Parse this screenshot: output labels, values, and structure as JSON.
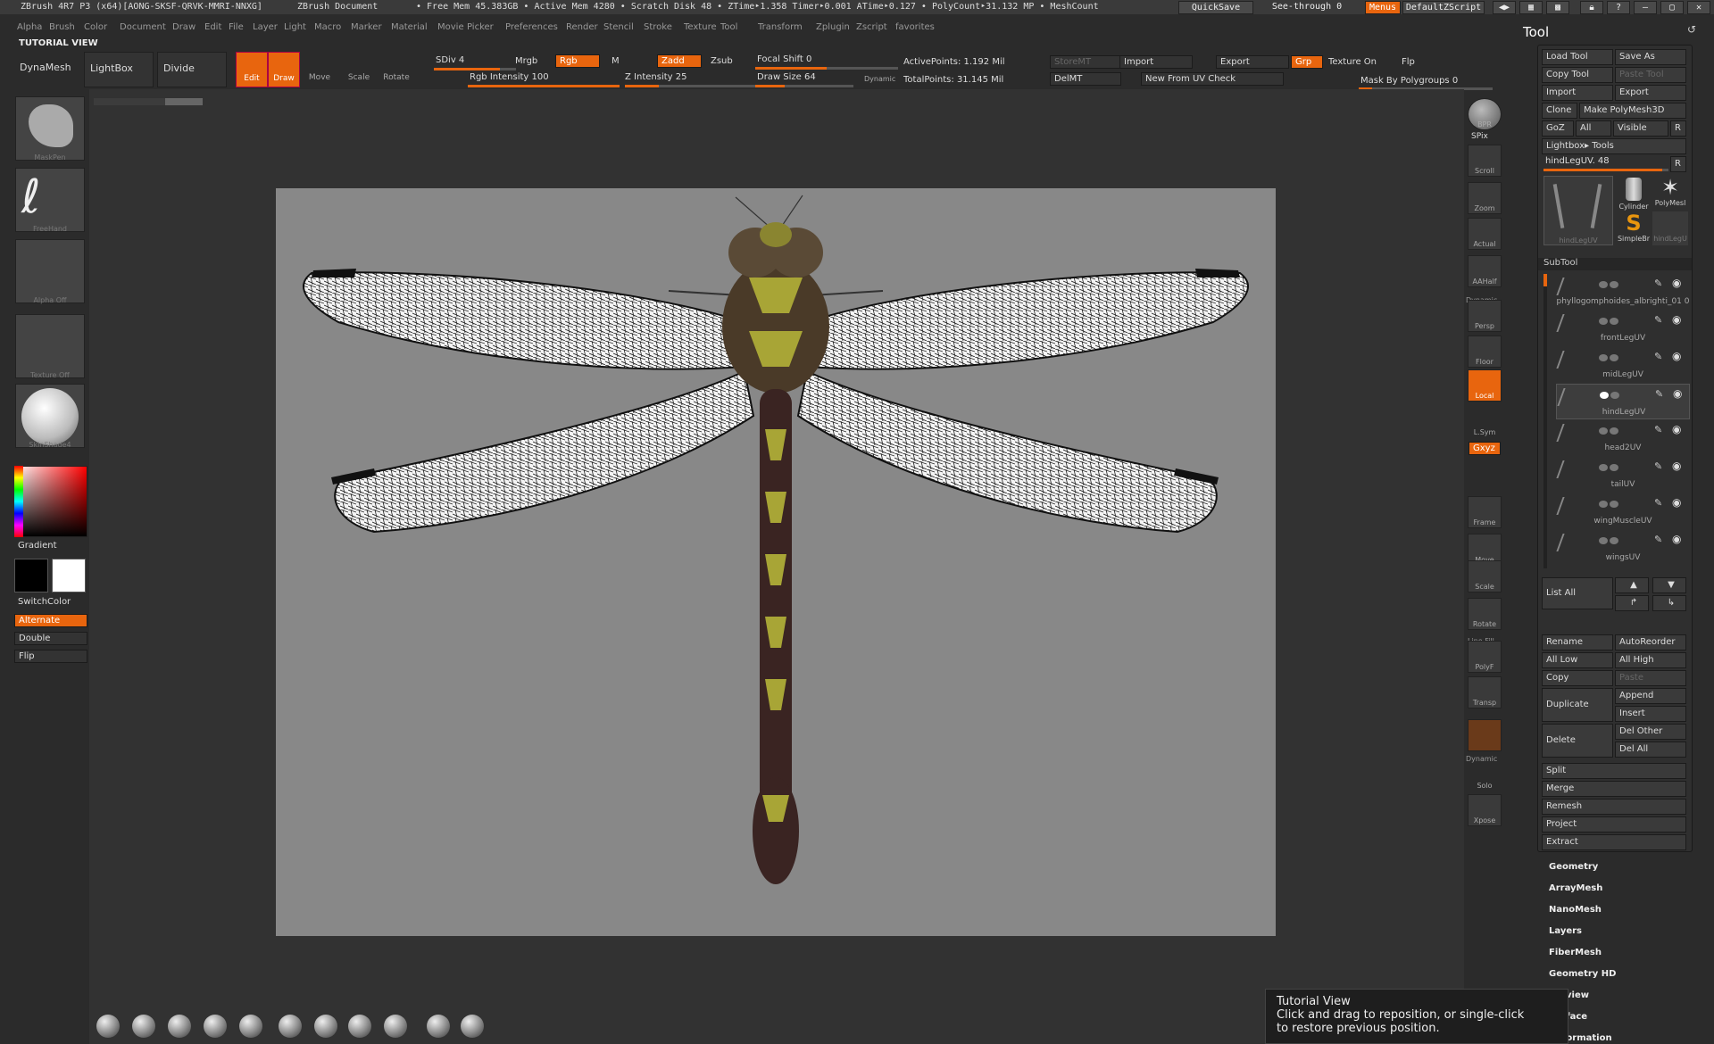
{
  "titlebar": {
    "app": "ZBrush 4R7 P3 (x64)[AONG-SKSF-QRVK-MMRI-NNXG]",
    "doc": "ZBrush Document",
    "stats": "• Free Mem 45.383GB • Active Mem 4280 • Scratch Disk 48 • ZTime‣1.358 Timer‣0.001 ATime‣0.127 • PolyCount‣31.132 MP • MeshCount",
    "quicksave": "QuickSave",
    "seethrough": "See-through  0",
    "menus": "Menus",
    "script": "DefaultZScript"
  },
  "menubar": [
    "Alpha",
    "Brush",
    "Color",
    "Document",
    "Draw",
    "Edit",
    "File",
    "Layer",
    "Light",
    "Macro",
    "Marker",
    "Material",
    "Movie",
    "Picker",
    "Preferences",
    "Render",
    "Stencil",
    "Stroke",
    "Texture",
    "Tool",
    "Transform",
    "Zplugin",
    "Zscript",
    "favorites"
  ],
  "tutorial_label": "TUTORIAL VIEW",
  "topshelf": {
    "dynamesh": "DynaMesh",
    "lightbox": "LightBox",
    "divide": "Divide",
    "tools": [
      "Edit",
      "Draw",
      "Move",
      "Scale",
      "Rotate"
    ],
    "sdiv": "SDiv 4",
    "mrgb": "Mrgb",
    "rgb": "Rgb",
    "m": "M",
    "zadd": "Zadd",
    "zsub": "Zsub",
    "rgb_intensity": "Rgb Intensity 100",
    "z_intensity": "Z Intensity 25",
    "focal_shift": "Focal Shift 0",
    "draw_size": "Draw Size 64",
    "dynamic": "Dynamic",
    "active_points": "ActivePoints: 1.192  Mil",
    "total_points": "TotalPoints: 31.145  Mil",
    "storemt": "StoreMT",
    "delmt": "DelMT",
    "import": "Import",
    "export": "Export",
    "grp": "Grp",
    "texture_on": "Texture On",
    "flp": "Flp",
    "new_from_uv": "New From UV Check",
    "mask_by_polygroups": "Mask By Polygroups 0"
  },
  "leftshelf": {
    "thumbs": [
      "MaskPen",
      "FreeHand",
      "Alpha  Off",
      "Texture  Off",
      "SkinShade4"
    ],
    "gradient": "Gradient",
    "switchcolor": "SwitchColor",
    "alternate": "Alternate",
    "double": "Double",
    "flip": "Flip"
  },
  "rightshelf": [
    "BPR",
    "SPix",
    "Scroll",
    "Zoom",
    "Actual",
    "AAHalf",
    "Dynamic",
    "Persp",
    "Floor",
    "Local",
    "L.Sym",
    "Gxyz",
    "Frame",
    "Move",
    "Scale",
    "Rotate",
    "Line Fill",
    "PolyF",
    "Transp",
    "Dynamic",
    "Solo",
    "Xpose"
  ],
  "toolpanel": {
    "title": "Tool",
    "load_tool": "Load Tool",
    "save_as": "Save As",
    "copy_tool": "Copy Tool",
    "paste_tool": "Paste Tool",
    "import": "Import",
    "export": "Export",
    "clone": "Clone",
    "make_polymesh": "Make PolyMesh3D",
    "goz": "GoZ",
    "all": "All",
    "visible": "Visible",
    "r": "R",
    "lightbox_tools": "Lightbox▸ Tools",
    "current_tool": "hindLegUV. 48",
    "thumbs": [
      "hindLegUV",
      "Cylinder",
      "PolyMesl",
      "SimpleBr",
      "hindLegU"
    ],
    "subtool_title": "SubTool",
    "subtools": [
      "phyllogomphoides_albrighti_01 0",
      "frontLegUV",
      "midLegUV",
      "hindLegUV",
      "head2UV",
      "tailUV",
      "wingMuscleUV",
      "wingsUV"
    ],
    "list_all": "List  All",
    "rename": "Rename",
    "autoreorder": "AutoReorder",
    "all_low": "All  Low",
    "all_high": "All  High",
    "copy": "Copy",
    "paste": "Paste",
    "duplicate": "Duplicate",
    "append": "Append",
    "insert": "Insert",
    "delete": "Delete",
    "del_other": "Del Other",
    "del_all": "Del  All",
    "split": "Split",
    "merge": "Merge",
    "remesh": "Remesh",
    "project": "Project",
    "extract": "Extract"
  },
  "tool_menus": [
    "Geometry",
    "ArrayMesh",
    "NanoMesh",
    "Layers",
    "FiberMesh",
    "Geometry HD",
    "Preview",
    "Surface",
    "Deformation"
  ],
  "tutorial_popup": {
    "title": "Tutorial View",
    "line1": "Click and drag to reposition, or single-click",
    "line2": "to restore previous position."
  },
  "colors": {
    "accent": "#e8650e",
    "bg": "#2b2b2b",
    "canvas": "#888888"
  }
}
